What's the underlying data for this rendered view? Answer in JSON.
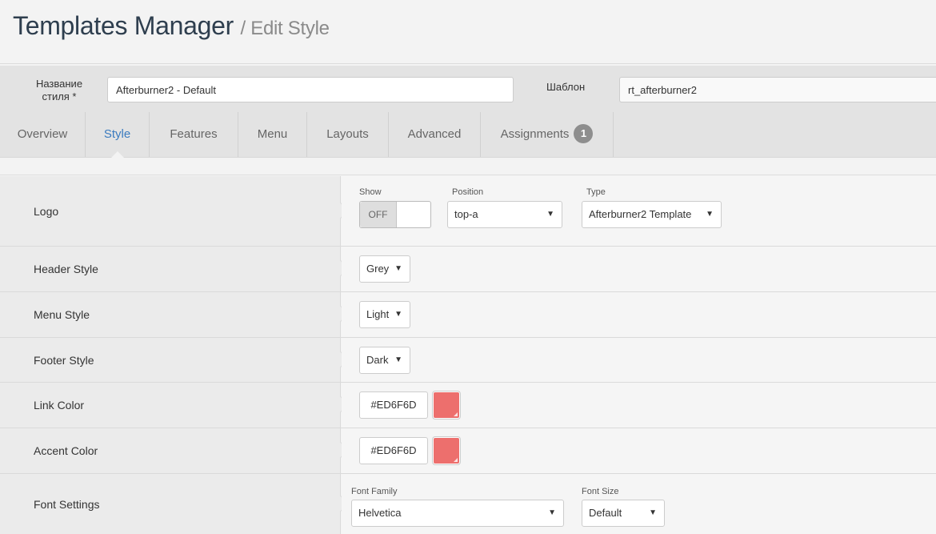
{
  "header": {
    "title": "Templates Manager",
    "subtitle": "/ Edit Style"
  },
  "style_name": {
    "label": "Название стиля *",
    "value": "Afterburner2 - Default"
  },
  "template": {
    "label": "Шаблон",
    "value": "rt_afterburner2"
  },
  "tabs": [
    {
      "label": "Overview"
    },
    {
      "label": "Style",
      "active": true
    },
    {
      "label": "Features"
    },
    {
      "label": "Menu"
    },
    {
      "label": "Layouts"
    },
    {
      "label": "Advanced"
    },
    {
      "label": "Assignments",
      "badge": "1"
    }
  ],
  "rows": {
    "logo": {
      "label": "Logo",
      "show_label": "Show",
      "show_value": "OFF",
      "position_label": "Position",
      "position_value": "top-a",
      "type_label": "Type",
      "type_value": "Afterburner2 Template"
    },
    "header_style": {
      "label": "Header Style",
      "value": "Grey"
    },
    "menu_style": {
      "label": "Menu Style",
      "value": "Light"
    },
    "footer_style": {
      "label": "Footer Style",
      "value": "Dark"
    },
    "link_color": {
      "label": "Link Color",
      "value": "#ED6F6D",
      "swatch": "#ED6F6D"
    },
    "accent_color": {
      "label": "Accent Color",
      "value": "#ED6F6D",
      "swatch": "#ED6F6D"
    },
    "font_settings": {
      "label": "Font Settings",
      "family_label": "Font Family",
      "family_value": "Helvetica",
      "size_label": "Font Size",
      "size_value": "Default"
    }
  },
  "icons": {
    "dropdown": "▼"
  }
}
